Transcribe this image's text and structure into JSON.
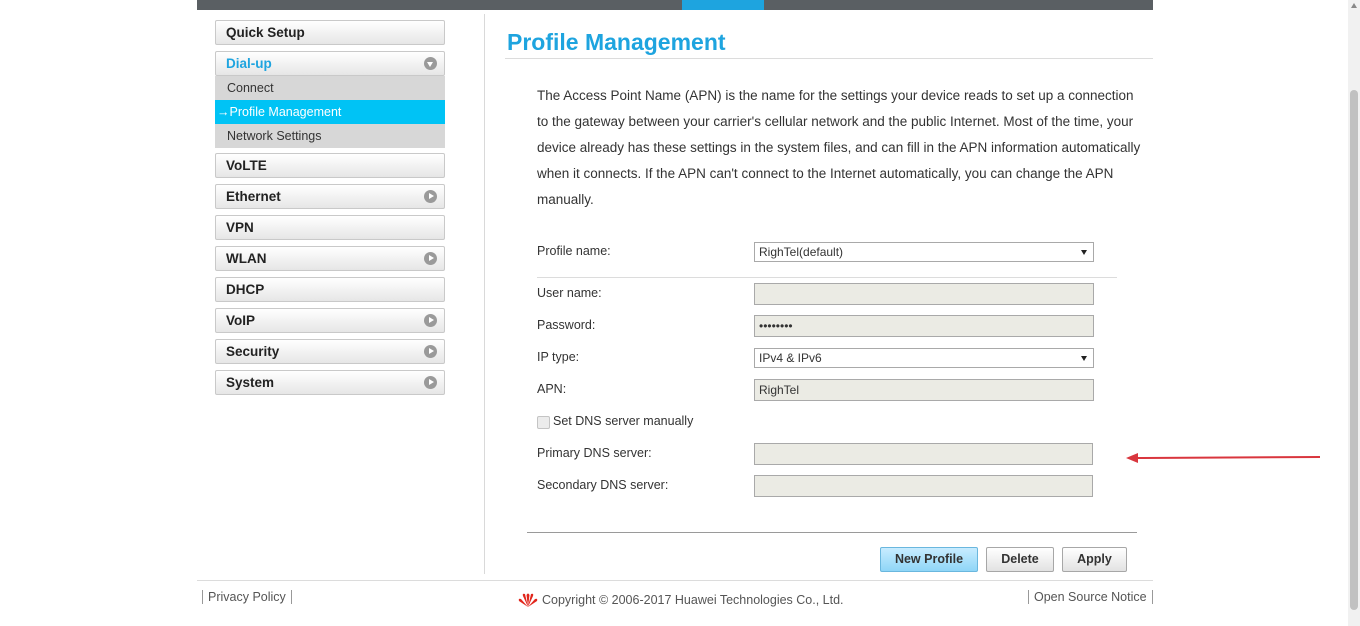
{
  "sidebar": {
    "items": [
      {
        "label": "Quick Setup",
        "has_arrow": false
      },
      {
        "label": "Dial-up",
        "expanded": true,
        "subitems": [
          {
            "label": "Connect"
          },
          {
            "label": "Profile Management",
            "active": true
          },
          {
            "label": "Network Settings"
          }
        ]
      },
      {
        "label": "VoLTE",
        "has_arrow": false
      },
      {
        "label": "Ethernet",
        "has_arrow": true
      },
      {
        "label": "VPN",
        "has_arrow": false
      },
      {
        "label": "WLAN",
        "has_arrow": true
      },
      {
        "label": "DHCP",
        "has_arrow": false
      },
      {
        "label": "VoIP",
        "has_arrow": true
      },
      {
        "label": "Security",
        "has_arrow": true
      },
      {
        "label": "System",
        "has_arrow": true
      }
    ],
    "active_marker": "→"
  },
  "main": {
    "title": "Profile Management",
    "description": "The Access Point Name (APN) is the name for the settings your device reads to set up a connection to the gateway between your carrier's cellular network and the public Internet. Most of the time, your device already has these settings in the system files, and can fill in the APN information automatically when it connects. If the APN can't connect to the Internet automatically, you can change the APN manually.",
    "form": {
      "profile_name": {
        "label": "Profile name:",
        "value": "RighTel(default)"
      },
      "user_name": {
        "label": "User name:",
        "value": ""
      },
      "password": {
        "label": "Password:",
        "value": "••••••••"
      },
      "ip_type": {
        "label": "IP type:",
        "value": "IPv4 & IPv6"
      },
      "apn": {
        "label": "APN:",
        "value": "RighTel"
      },
      "set_dns_manually": {
        "label": "Set DNS server manually",
        "checked": false
      },
      "primary_dns": {
        "label": "Primary DNS server:",
        "value": ""
      },
      "secondary_dns": {
        "label": "Secondary DNS server:",
        "value": ""
      }
    },
    "buttons": {
      "new_profile": "New Profile",
      "delete": "Delete",
      "apply": "Apply"
    }
  },
  "footer": {
    "privacy_policy": "Privacy Policy",
    "copyright": "Copyright © 2006-2017 Huawei Technologies Co., Ltd.",
    "open_source_notice": "Open Source Notice"
  },
  "colors": {
    "accent": "#1ea4df",
    "active_nav": "#00c3f5",
    "annotation_arrow": "#d9363e",
    "brand_logo": "#e1261c"
  }
}
